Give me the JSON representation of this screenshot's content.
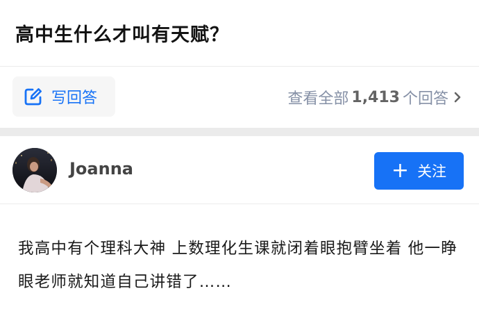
{
  "question": {
    "title": "高中生什么才叫有天赋？"
  },
  "actions": {
    "write_answer_label": "写回答",
    "view_all_prefix": "查看全部",
    "answer_count": "1,413",
    "view_all_suffix": "个回答",
    "accent_color": "#1772f6"
  },
  "author": {
    "name": "Joanna",
    "follow_label": "关注",
    "follow_plus": "+"
  },
  "answer": {
    "text": "我高中有个理科大神 上数理化生课就闭着眼抱臂坐着 他一睁眼老师就知道自己讲错了……"
  }
}
